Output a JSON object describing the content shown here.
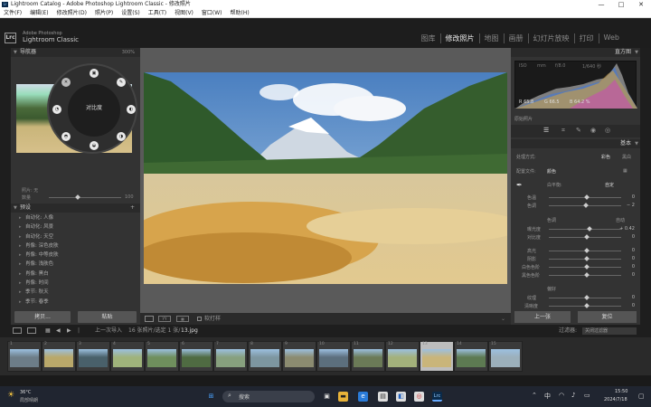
{
  "window": {
    "title": "Lightroom Catalog - Adobe Photoshop Lightroom Classic - 修改照片",
    "controls": [
      "—",
      "□",
      "✕"
    ]
  },
  "menu": [
    "文件(F)",
    "编辑(E)",
    "修改照片(D)",
    "照片(P)",
    "设置(S)",
    "工具(T)",
    "视图(V)",
    "窗口(W)",
    "帮助(H)"
  ],
  "brand": {
    "badge": "Lrc",
    "line1": "Adobe Photoshop",
    "line2": "Lightroom Classic"
  },
  "modules": [
    {
      "label": "图库",
      "active": false
    },
    {
      "label": "修改照片",
      "active": true
    },
    {
      "label": "地图",
      "active": false
    },
    {
      "label": "画册",
      "active": false
    },
    {
      "label": "幻灯片放映",
      "active": false
    },
    {
      "label": "打印",
      "active": false
    },
    {
      "label": "Web",
      "active": false
    }
  ],
  "left": {
    "navigator_title": "导航器",
    "navigator_zoom": [
      "适合",
      "100%",
      "300%"
    ],
    "radial_label": "对比度",
    "radial_rows": [
      "照片: 无",
      "数量"
    ],
    "amount_value": "100",
    "presets_title": "预设",
    "presets": [
      "自动化: 人像",
      "自动化: 风景",
      "自动化: 天空",
      "肖像: 深色皮肤",
      "肖像: 中等皮肤",
      "肖像: 浅肤色",
      "肖像: 黑白",
      "肖像: 时间",
      "季节: 秋天",
      "季节: 春季",
      "季节: 夏季",
      "季节: 冬季"
    ],
    "copy_button": "拷贝...",
    "paste_button": "粘贴"
  },
  "toolbar": {
    "softproof": "软打样"
  },
  "right": {
    "histogram_title": "直方图",
    "histo_info": {
      "iso": "ISO",
      "mm": "mm",
      "f": "f/8.0",
      "s": "1/640 秒"
    },
    "histo_readout": [
      "R 65.8",
      "G 66.5",
      "B 64.2 %"
    ],
    "original_photo": "原始照片",
    "basic_title": "基本",
    "treatment_label": "处理方式:",
    "treatment_color": "彩色",
    "treatment_bw": "黑白",
    "profile_label": "配置文件:",
    "profile_value": "颜色",
    "wb_label": "白平衡:",
    "wb_value": "自定",
    "tone_label": "色调",
    "tone_auto": "自动",
    "presence_label": "偏好",
    "sliders": [
      {
        "label": "色温",
        "value": "0"
      },
      {
        "label": "色调",
        "value": "− 2"
      },
      {
        "label": "曝光度",
        "value": "+ 0.42"
      },
      {
        "label": "对比度",
        "value": "0"
      },
      {
        "label": "高光",
        "value": "0"
      },
      {
        "label": "阴影",
        "value": "0"
      },
      {
        "label": "白色色阶",
        "value": "0"
      },
      {
        "label": "黑色色阶",
        "value": "0"
      },
      {
        "label": "纹理",
        "value": "0"
      },
      {
        "label": "清晰度",
        "value": "0"
      },
      {
        "label": "去朦胧",
        "value": "0"
      }
    ],
    "prev_button": "上一张",
    "reset_button": "复位"
  },
  "filmstrip": {
    "nav_text": "上一次导入",
    "count_text": "16 张照片/选定 1 张/",
    "file_text": "13.jpg",
    "filter_label": "过滤器:",
    "filter_value": "关闭过滤器",
    "thumbs": [
      {
        "n": "1",
        "c": "#6d7d88"
      },
      {
        "n": "2",
        "c": "#b9a86a"
      },
      {
        "n": "3",
        "c": "#49606a"
      },
      {
        "n": "4",
        "c": "#9fb37b"
      },
      {
        "n": "5",
        "c": "#6f8f5d"
      },
      {
        "n": "6",
        "c": "#4f6b42"
      },
      {
        "n": "7",
        "c": "#87a07e"
      },
      {
        "n": "8",
        "c": "#7d96a0"
      },
      {
        "n": "9",
        "c": "#8b8b70"
      },
      {
        "n": "10",
        "c": "#5c6f7d"
      },
      {
        "n": "11",
        "c": "#6b7a57"
      },
      {
        "n": "12",
        "c": "#a3b17b"
      },
      {
        "n": "13",
        "c": "#c9b57a",
        "selected": true
      },
      {
        "n": "14",
        "c": "#5d7a52"
      },
      {
        "n": "15",
        "c": "#9cb0bb"
      }
    ]
  },
  "taskbar": {
    "weather_temp": "36°C",
    "weather_desc": "局部晴朗",
    "search": "搜索",
    "lang": "中",
    "time": "15:50",
    "date": "2024/7/18"
  }
}
